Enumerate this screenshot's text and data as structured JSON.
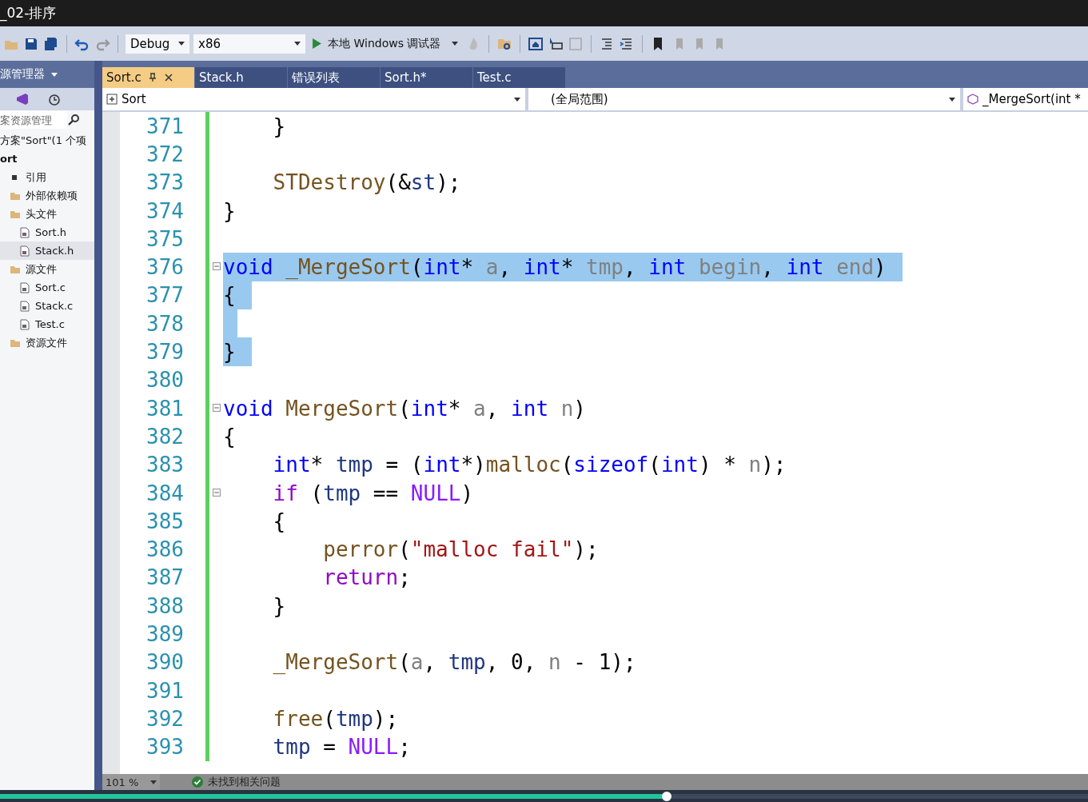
{
  "window": {
    "title": "_02-排序"
  },
  "toolbar": {
    "configuration": "Debug",
    "platform": "x86",
    "run_label": "本地 Windows 调试器"
  },
  "solution_explorer": {
    "title": "源管理器",
    "search_placeholder": "案资源管理",
    "tree": [
      {
        "label": "方案\"Sort\"(1 个项",
        "selected": false,
        "children": [
          {
            "label": "ort",
            "kind": "project",
            "selected": false,
            "children": [
              {
                "label": "引用",
                "kind": "refs",
                "selected": false
              },
              {
                "label": "外部依赖项",
                "kind": "folder",
                "selected": false
              },
              {
                "label": "头文件",
                "kind": "folder",
                "selected": false,
                "children": [
                  {
                    "label": "Sort.h",
                    "kind": "header",
                    "selected": false
                  },
                  {
                    "label": "Stack.h",
                    "kind": "header",
                    "selected": true
                  }
                ]
              },
              {
                "label": "源文件",
                "kind": "folder",
                "selected": false,
                "children": [
                  {
                    "label": "Sort.c",
                    "kind": "source",
                    "selected": false
                  },
                  {
                    "label": "Stack.c",
                    "kind": "source",
                    "selected": false
                  },
                  {
                    "label": "Test.c",
                    "kind": "source",
                    "selected": false
                  }
                ]
              },
              {
                "label": "资源文件",
                "kind": "folder",
                "selected": false
              }
            ]
          }
        ]
      }
    ]
  },
  "tabs": [
    {
      "label": "Sort.c",
      "selected": true
    },
    {
      "label": "Stack.h",
      "selected": false
    },
    {
      "label": "错误列表",
      "selected": false
    },
    {
      "label": "Sort.h*",
      "selected": false
    },
    {
      "label": "Test.c",
      "selected": false
    }
  ],
  "nav": {
    "project": "Sort",
    "scope": "(全局范围)",
    "member": "_MergeSort(int *"
  },
  "code": [
    {
      "n": "371",
      "selected": false,
      "fold": false,
      "tokens": [
        {
          "t": "    }",
          "kind": "plain"
        }
      ]
    },
    {
      "n": "372",
      "selected": false,
      "fold": false
    },
    {
      "n": "373",
      "selected": false,
      "fold": false,
      "tokens": [
        {
          "t": "    STDestroy",
          "kind": "function"
        },
        {
          "t": "(&",
          "kind": "plain"
        },
        {
          "t": "st",
          "kind": "local"
        },
        {
          "t": ");",
          "kind": "plain"
        }
      ]
    },
    {
      "n": "374",
      "selected": false,
      "fold": false,
      "tokens": [
        {
          "t": "}",
          "kind": "plain"
        }
      ]
    },
    {
      "n": "375",
      "selected": false,
      "fold": false
    },
    {
      "n": "376",
      "selected": true,
      "fold": true,
      "tokens": [
        {
          "t": "void ",
          "kind": "keyword"
        },
        {
          "t": "_MergeSort",
          "kind": "function"
        },
        {
          "t": "(",
          "kind": "plain"
        },
        {
          "t": "int",
          "kind": "keyword"
        },
        {
          "t": "* ",
          "kind": "plain"
        },
        {
          "t": "a",
          "kind": "param"
        },
        {
          "t": ", ",
          "kind": "plain"
        },
        {
          "t": "int",
          "kind": "keyword"
        },
        {
          "t": "* ",
          "kind": "plain"
        },
        {
          "t": "tmp",
          "kind": "param"
        },
        {
          "t": ", ",
          "kind": "plain"
        },
        {
          "t": "int ",
          "kind": "keyword"
        },
        {
          "t": "begin",
          "kind": "param"
        },
        {
          "t": ", ",
          "kind": "plain"
        },
        {
          "t": "int ",
          "kind": "keyword"
        },
        {
          "t": "end",
          "kind": "param"
        },
        {
          "t": ")",
          "kind": "plain"
        }
      ]
    },
    {
      "n": "377",
      "selected": true,
      "fold": false,
      "tokens": [
        {
          "t": "{",
          "kind": "plain"
        }
      ]
    },
    {
      "n": "378",
      "selected": true,
      "fold": false
    },
    {
      "n": "379",
      "selected": true,
      "fold": false,
      "tokens": [
        {
          "t": "}",
          "kind": "plain"
        }
      ]
    },
    {
      "n": "380",
      "selected": false,
      "fold": false
    },
    {
      "n": "381",
      "selected": false,
      "fold": true,
      "tokens": [
        {
          "t": "void ",
          "kind": "keyword"
        },
        {
          "t": "MergeSort",
          "kind": "function"
        },
        {
          "t": "(",
          "kind": "plain"
        },
        {
          "t": "int",
          "kind": "keyword"
        },
        {
          "t": "* ",
          "kind": "plain"
        },
        {
          "t": "a",
          "kind": "param"
        },
        {
          "t": ", ",
          "kind": "plain"
        },
        {
          "t": "int ",
          "kind": "keyword"
        },
        {
          "t": "n",
          "kind": "param"
        },
        {
          "t": ")",
          "kind": "plain"
        }
      ]
    },
    {
      "n": "382",
      "selected": false,
      "fold": false,
      "tokens": [
        {
          "t": "{",
          "kind": "plain"
        }
      ]
    },
    {
      "n": "383",
      "selected": false,
      "fold": false,
      "tokens": [
        {
          "t": "    int",
          "kind": "keyword"
        },
        {
          "t": "* ",
          "kind": "plain"
        },
        {
          "t": "tmp",
          "kind": "local"
        },
        {
          "t": " = (",
          "kind": "plain"
        },
        {
          "t": "int",
          "kind": "keyword"
        },
        {
          "t": "*)",
          "kind": "plain"
        },
        {
          "t": "malloc",
          "kind": "function"
        },
        {
          "t": "(",
          "kind": "plain"
        },
        {
          "t": "sizeof",
          "kind": "keyword"
        },
        {
          "t": "(",
          "kind": "plain"
        },
        {
          "t": "int",
          "kind": "keyword"
        },
        {
          "t": ") * ",
          "kind": "plain"
        },
        {
          "t": "n",
          "kind": "param"
        },
        {
          "t": ");",
          "kind": "plain"
        }
      ]
    },
    {
      "n": "384",
      "selected": false,
      "fold": true,
      "tokens": [
        {
          "t": "    if",
          "kind": "control"
        },
        {
          "t": " (",
          "kind": "plain"
        },
        {
          "t": "tmp",
          "kind": "local"
        },
        {
          "t": " == ",
          "kind": "plain"
        },
        {
          "t": "NULL",
          "kind": "macro"
        },
        {
          "t": ")",
          "kind": "plain"
        }
      ]
    },
    {
      "n": "385",
      "selected": false,
      "fold": false,
      "tokens": [
        {
          "t": "    {",
          "kind": "plain"
        }
      ]
    },
    {
      "n": "386",
      "selected": false,
      "fold": false,
      "tokens": [
        {
          "t": "        perror",
          "kind": "function"
        },
        {
          "t": "(",
          "kind": "plain"
        },
        {
          "t": "\"malloc fail\"",
          "kind": "string"
        },
        {
          "t": ");",
          "kind": "plain"
        }
      ]
    },
    {
      "n": "387",
      "selected": false,
      "fold": false,
      "tokens": [
        {
          "t": "        return",
          "kind": "control"
        },
        {
          "t": ";",
          "kind": "plain"
        }
      ]
    },
    {
      "n": "388",
      "selected": false,
      "fold": false,
      "tokens": [
        {
          "t": "    }",
          "kind": "plain"
        }
      ]
    },
    {
      "n": "389",
      "selected": false,
      "fold": false
    },
    {
      "n": "390",
      "selected": false,
      "fold": false,
      "tokens": [
        {
          "t": "    _MergeSort",
          "kind": "function"
        },
        {
          "t": "(",
          "kind": "plain"
        },
        {
          "t": "a",
          "kind": "param"
        },
        {
          "t": ", ",
          "kind": "plain"
        },
        {
          "t": "tmp",
          "kind": "local"
        },
        {
          "t": ", 0, ",
          "kind": "plain"
        },
        {
          "t": "n",
          "kind": "param"
        },
        {
          "t": " - 1);",
          "kind": "plain"
        }
      ]
    },
    {
      "n": "391",
      "selected": false,
      "fold": false
    },
    {
      "n": "392",
      "selected": false,
      "fold": false,
      "tokens": [
        {
          "t": "    free",
          "kind": "function"
        },
        {
          "t": "(",
          "kind": "plain"
        },
        {
          "t": "tmp",
          "kind": "local"
        },
        {
          "t": ");",
          "kind": "plain"
        }
      ]
    },
    {
      "n": "393",
      "selected": false,
      "fold": false,
      "tokens": [
        {
          "t": "    tmp",
          "kind": "local"
        },
        {
          "t": " = ",
          "kind": "plain"
        },
        {
          "t": "NULL",
          "kind": "macro"
        },
        {
          "t": ";",
          "kind": "plain"
        }
      ]
    }
  ],
  "status_bar": {
    "zoom": "101 %",
    "issues": "未找到相关问题"
  },
  "video_progress": {
    "level": 0.613
  }
}
